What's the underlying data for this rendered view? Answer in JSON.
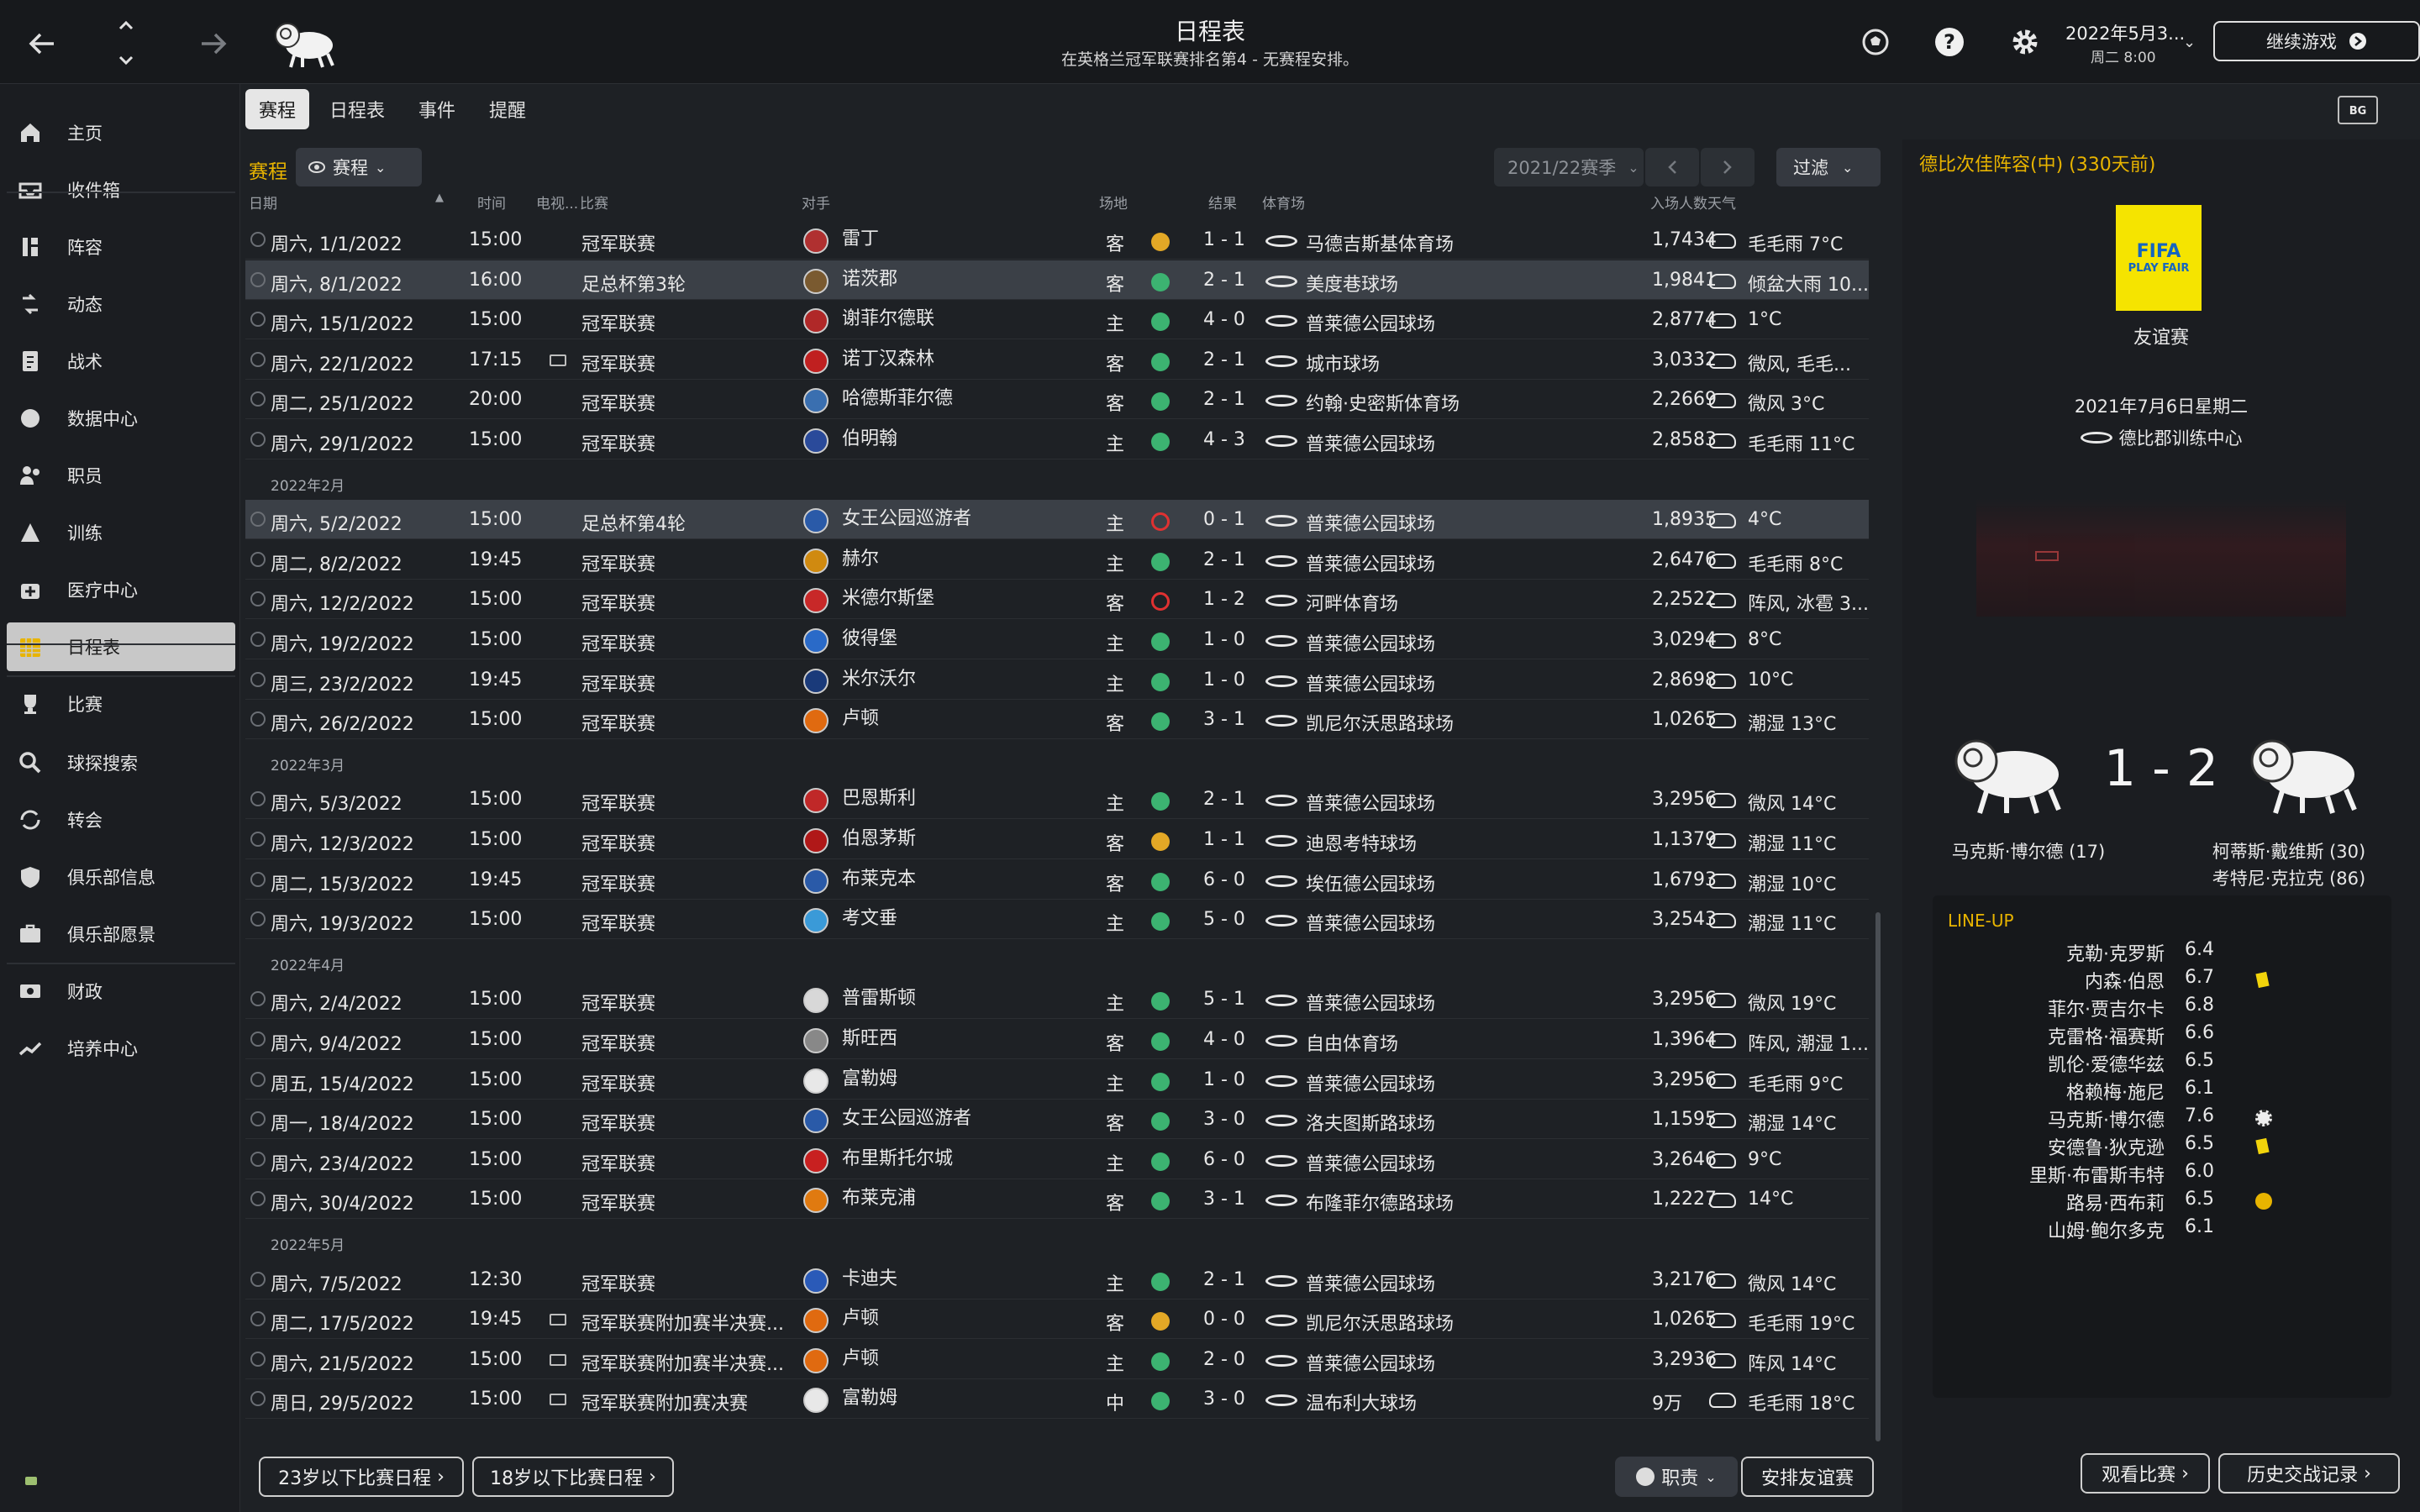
{
  "header": {
    "title": "日程表",
    "subtitle": "在英格兰冠军联赛排名第4 - 无赛程安排。",
    "date": "2022年5月3...",
    "time": "周二 8:00",
    "continue_label": "继续游戏"
  },
  "sidebar": {
    "items": [
      {
        "label": "主页",
        "icon": "home-icon"
      },
      {
        "label": "收件箱",
        "icon": "inbox-icon"
      },
      {
        "label": "阵容",
        "icon": "squad-icon"
      },
      {
        "label": "动态",
        "icon": "dynamics-icon"
      },
      {
        "label": "战术",
        "icon": "tactics-icon"
      },
      {
        "label": "数据中心",
        "icon": "data-hub-icon"
      },
      {
        "label": "职员",
        "icon": "staff-icon"
      },
      {
        "label": "训练",
        "icon": "training-icon"
      },
      {
        "label": "医疗中心",
        "icon": "medical-icon"
      },
      {
        "label": "日程表",
        "icon": "calendar-icon",
        "active": true
      },
      {
        "label": "比赛",
        "icon": "trophy-icon"
      },
      {
        "label": "球探搜索",
        "icon": "scouting-icon"
      },
      {
        "label": "转会",
        "icon": "transfers-icon"
      },
      {
        "label": "俱乐部信息",
        "icon": "club-info-icon"
      },
      {
        "label": "俱乐部愿景",
        "icon": "club-vision-icon"
      },
      {
        "label": "财政",
        "icon": "finances-icon"
      },
      {
        "label": "培养中心",
        "icon": "development-icon"
      }
    ]
  },
  "tabs": [
    {
      "label": "赛程",
      "active": true
    },
    {
      "label": "日程表"
    },
    {
      "label": "事件"
    },
    {
      "label": "提醒"
    }
  ],
  "toolbar": {
    "section_title": "赛程",
    "view_dropdown": "赛程",
    "season": "2021/22赛季",
    "filter_label": "过滤"
  },
  "columns": {
    "date": "日期",
    "time": "时间",
    "tv": "电视...",
    "competition": "比赛",
    "opponent": "对手",
    "venue": "场地",
    "result": "结果",
    "stadium": "体育场",
    "attendance": "入场人数",
    "weather": "天气"
  },
  "fixtures": [
    {
      "date": "周六, 1/1/2022",
      "time": "15:00",
      "tv": false,
      "comp": "冠军联赛",
      "opp": "雷丁",
      "venue": "客",
      "rc": "D",
      "result": "1 - 1",
      "stadium": "马德吉斯基体育场",
      "att": "1,7434",
      "weather": "毛毛雨 7°C",
      "crest": "#b03030"
    },
    {
      "date": "周六, 8/1/2022",
      "time": "16:00",
      "tv": false,
      "comp": "足总杯第3轮",
      "opp": "诺茨郡",
      "venue": "客",
      "rc": "W",
      "result": "2 - 1",
      "stadium": "美度巷球场",
      "att": "1,9841",
      "weather": "倾盆大雨 10...",
      "crest": "#7a5a30",
      "hl": true
    },
    {
      "date": "周六, 15/1/2022",
      "time": "15:00",
      "tv": false,
      "comp": "冠军联赛",
      "opp": "谢菲尔德联",
      "venue": "主",
      "rc": "W",
      "result": "4 - 0",
      "stadium": "普莱德公园球场",
      "att": "2,8774",
      "weather": "1°C",
      "crest": "#b02828"
    },
    {
      "date": "周六, 22/1/2022",
      "time": "17:15",
      "tv": true,
      "comp": "冠军联赛",
      "opp": "诺丁汉森林",
      "venue": "客",
      "rc": "W",
      "result": "2 - 1",
      "stadium": "城市球场",
      "att": "3,0332",
      "weather": "微风, 毛毛...",
      "crest": "#c02020"
    },
    {
      "date": "周二, 25/1/2022",
      "time": "20:00",
      "tv": false,
      "comp": "冠军联赛",
      "opp": "哈德斯菲尔德",
      "venue": "客",
      "rc": "W",
      "result": "2 - 1",
      "stadium": "约翰·史密斯体育场",
      "att": "2,2669",
      "weather": "微风 3°C",
      "crest": "#3a6fb0"
    },
    {
      "date": "周六, 29/1/2022",
      "time": "15:00",
      "tv": false,
      "comp": "冠军联赛",
      "opp": "伯明翰",
      "venue": "主",
      "rc": "W",
      "result": "4 - 3",
      "stadium": "普莱德公园球场",
      "att": "2,8583",
      "weather": "毛毛雨 11°C",
      "crest": "#2a4a9a"
    },
    {
      "month": "2022年2月"
    },
    {
      "date": "周六, 5/2/2022",
      "time": "15:00",
      "tv": false,
      "comp": "足总杯第4轮",
      "opp": "女王公园巡游者",
      "venue": "主",
      "rc": "L",
      "result": "0 - 1",
      "stadium": "普莱德公园球场",
      "att": "1,8935",
      "weather": "4°C",
      "crest": "#2a5aa8",
      "hl": true
    },
    {
      "date": "周二, 8/2/2022",
      "time": "19:45",
      "tv": false,
      "comp": "冠军联赛",
      "opp": "赫尔",
      "venue": "主",
      "rc": "W",
      "result": "2 - 1",
      "stadium": "普莱德公园球场",
      "att": "2,6476",
      "weather": "毛毛雨 8°C",
      "crest": "#d08a10"
    },
    {
      "date": "周六, 12/2/2022",
      "time": "15:00",
      "tv": false,
      "comp": "冠军联赛",
      "opp": "米德尔斯堡",
      "venue": "客",
      "rc": "L",
      "result": "1 - 2",
      "stadium": "河畔体育场",
      "att": "2,2522",
      "weather": "阵风, 冰雹 3...",
      "crest": "#c82828"
    },
    {
      "date": "周六, 19/2/2022",
      "time": "15:00",
      "tv": false,
      "comp": "冠军联赛",
      "opp": "彼得堡",
      "venue": "主",
      "rc": "W",
      "result": "1 - 0",
      "stadium": "普莱德公园球场",
      "att": "3,0294",
      "weather": "8°C",
      "crest": "#2a6ac8"
    },
    {
      "date": "周三, 23/2/2022",
      "time": "19:45",
      "tv": false,
      "comp": "冠军联赛",
      "opp": "米尔沃尔",
      "venue": "主",
      "rc": "W",
      "result": "1 - 0",
      "stadium": "普莱德公园球场",
      "att": "2,8698",
      "weather": "10°C",
      "crest": "#1a3a7a"
    },
    {
      "date": "周六, 26/2/2022",
      "time": "15:00",
      "tv": false,
      "comp": "冠军联赛",
      "opp": "卢顿",
      "venue": "客",
      "rc": "W",
      "result": "3 - 1",
      "stadium": "凯尼尔沃思路球场",
      "att": "1,0265",
      "weather": "潮湿 13°C",
      "crest": "#e06a10"
    },
    {
      "month": "2022年3月"
    },
    {
      "date": "周六, 5/3/2022",
      "time": "15:00",
      "tv": false,
      "comp": "冠军联赛",
      "opp": "巴恩斯利",
      "venue": "主",
      "rc": "W",
      "result": "2 - 1",
      "stadium": "普莱德公园球场",
      "att": "3,2956",
      "weather": "微风 14°C",
      "crest": "#c02828"
    },
    {
      "date": "周六, 12/3/2022",
      "time": "15:00",
      "tv": false,
      "comp": "冠军联赛",
      "opp": "伯恩茅斯",
      "venue": "客",
      "rc": "D",
      "result": "1 - 1",
      "stadium": "迪恩考特球场",
      "att": "1,1379",
      "weather": "潮湿 11°C",
      "crest": "#b01818"
    },
    {
      "date": "周二, 15/3/2022",
      "time": "19:45",
      "tv": false,
      "comp": "冠军联赛",
      "opp": "布莱克本",
      "venue": "客",
      "rc": "W",
      "result": "6 - 0",
      "stadium": "埃伍德公园球场",
      "att": "1,6793",
      "weather": "潮湿 10°C",
      "crest": "#2a5aa8"
    },
    {
      "date": "周六, 19/3/2022",
      "time": "15:00",
      "tv": false,
      "comp": "冠军联赛",
      "opp": "考文垂",
      "venue": "主",
      "rc": "W",
      "result": "5 - 0",
      "stadium": "普莱德公园球场",
      "att": "3,2543",
      "weather": "潮湿 11°C",
      "crest": "#3a9ad8"
    },
    {
      "month": "2022年4月"
    },
    {
      "date": "周六, 2/4/2022",
      "time": "15:00",
      "tv": false,
      "comp": "冠军联赛",
      "opp": "普雷斯顿",
      "venue": "主",
      "rc": "W",
      "result": "5 - 1",
      "stadium": "普莱德公园球场",
      "att": "3,2956",
      "weather": "微风 19°C",
      "crest": "#d8d8d8"
    },
    {
      "date": "周六, 9/4/2022",
      "time": "15:00",
      "tv": false,
      "comp": "冠军联赛",
      "opp": "斯旺西",
      "venue": "客",
      "rc": "W",
      "result": "4 - 0",
      "stadium": "自由体育场",
      "att": "1,3964",
      "weather": "阵风, 潮湿 1...",
      "crest": "#888888"
    },
    {
      "date": "周五, 15/4/2022",
      "time": "15:00",
      "tv": false,
      "comp": "冠军联赛",
      "opp": "富勒姆",
      "venue": "主",
      "rc": "W",
      "result": "1 - 0",
      "stadium": "普莱德公园球场",
      "att": "3,2956",
      "weather": "毛毛雨 9°C",
      "crest": "#e8e8e8"
    },
    {
      "date": "周一, 18/4/2022",
      "time": "15:00",
      "tv": false,
      "comp": "冠军联赛",
      "opp": "女王公园巡游者",
      "venue": "客",
      "rc": "W",
      "result": "3 - 0",
      "stadium": "洛夫图斯路球场",
      "att": "1,1595",
      "weather": "潮湿 14°C",
      "crest": "#2a5aa8"
    },
    {
      "date": "周六, 23/4/2022",
      "time": "15:00",
      "tv": false,
      "comp": "冠军联赛",
      "opp": "布里斯托尔城",
      "venue": "主",
      "rc": "W",
      "result": "6 - 0",
      "stadium": "普莱德公园球场",
      "att": "3,2646",
      "weather": "9°C",
      "crest": "#c82020"
    },
    {
      "date": "周六, 30/4/2022",
      "time": "15:00",
      "tv": false,
      "comp": "冠军联赛",
      "opp": "布莱克浦",
      "venue": "客",
      "rc": "W",
      "result": "3 - 1",
      "stadium": "布隆菲尔德路球场",
      "att": "1,2227",
      "weather": "14°C",
      "crest": "#e07a10"
    },
    {
      "month": "2022年5月"
    },
    {
      "date": "周六, 7/5/2022",
      "time": "12:30",
      "tv": false,
      "comp": "冠军联赛",
      "opp": "卡迪夫",
      "venue": "主",
      "rc": "W",
      "result": "2 - 1",
      "stadium": "普莱德公园球场",
      "att": "3,2176",
      "weather": "微风 14°C",
      "crest": "#2a5ab8"
    },
    {
      "date": "周二, 17/5/2022",
      "time": "19:45",
      "tv": true,
      "comp": "冠军联赛附加赛半决赛...",
      "opp": "卢顿",
      "venue": "客",
      "rc": "D",
      "result": "0 - 0",
      "stadium": "凯尼尔沃思路球场",
      "att": "1,0265",
      "weather": "毛毛雨 19°C",
      "crest": "#e06a10"
    },
    {
      "date": "周六, 21/5/2022",
      "time": "15:00",
      "tv": true,
      "comp": "冠军联赛附加赛半决赛...",
      "opp": "卢顿",
      "venue": "主",
      "rc": "W",
      "result": "2 - 0",
      "stadium": "普莱德公园球场",
      "att": "3,2936",
      "weather": "阵风 14°C",
      "crest": "#e06a10"
    },
    {
      "date": "周日, 29/5/2022",
      "time": "15:00",
      "tv": true,
      "comp": "冠军联赛附加赛决赛",
      "opp": "富勒姆",
      "venue": "中",
      "rc": "W",
      "result": "3 - 0",
      "stadium": "温布利大球场",
      "att": "9万",
      "weather": "毛毛雨 18°C",
      "crest": "#e8e8e8"
    }
  ],
  "bottom": {
    "u23": "23岁以下比赛日程",
    "u18": "18岁以下比赛日程",
    "duty": "职责",
    "arrange": "安排友谊赛"
  },
  "panel": {
    "title": "德比次佳阵容(中) (330天前)",
    "logo_top": "FIFA",
    "logo_bottom": "PLAY FAIR",
    "comp": "友谊赛",
    "date": "2021年7月6日星期二",
    "venue": "德比郡训练中心",
    "score": "1 - 2",
    "home_scorers": [
      "马克斯·博尔德 (17)"
    ],
    "away_scorers": [
      "柯蒂斯·戴维斯 (30)",
      "考特尼·克拉克 (86)"
    ],
    "lineup_title": "LINE-UP",
    "lineup": [
      {
        "name": "克勒·克罗斯",
        "rating": "6.4",
        "mark": ""
      },
      {
        "name": "内森·伯恩",
        "rating": "6.7",
        "mark": "yellow"
      },
      {
        "name": "菲尔·贾吉尔卡",
        "rating": "6.8",
        "mark": ""
      },
      {
        "name": "克雷格·福赛斯",
        "rating": "6.6",
        "mark": ""
      },
      {
        "name": "凯伦·爱德华兹",
        "rating": "6.5",
        "mark": ""
      },
      {
        "name": "格赖梅·施尼",
        "rating": "6.1",
        "mark": ""
      },
      {
        "name": "马克斯·博尔德",
        "rating": "7.6",
        "mark": "goal"
      },
      {
        "name": "安德鲁·狄克逊",
        "rating": "6.5",
        "mark": "yellow"
      },
      {
        "name": "里斯·布雷斯韦特",
        "rating": "6.0",
        "mark": ""
      },
      {
        "name": "路易·西布莉",
        "rating": "6.5",
        "mark": "sub"
      },
      {
        "name": "山姆·鲍尔多克",
        "rating": "6.1",
        "mark": ""
      }
    ],
    "watch": "观看比赛",
    "history": "历史交战记录"
  }
}
